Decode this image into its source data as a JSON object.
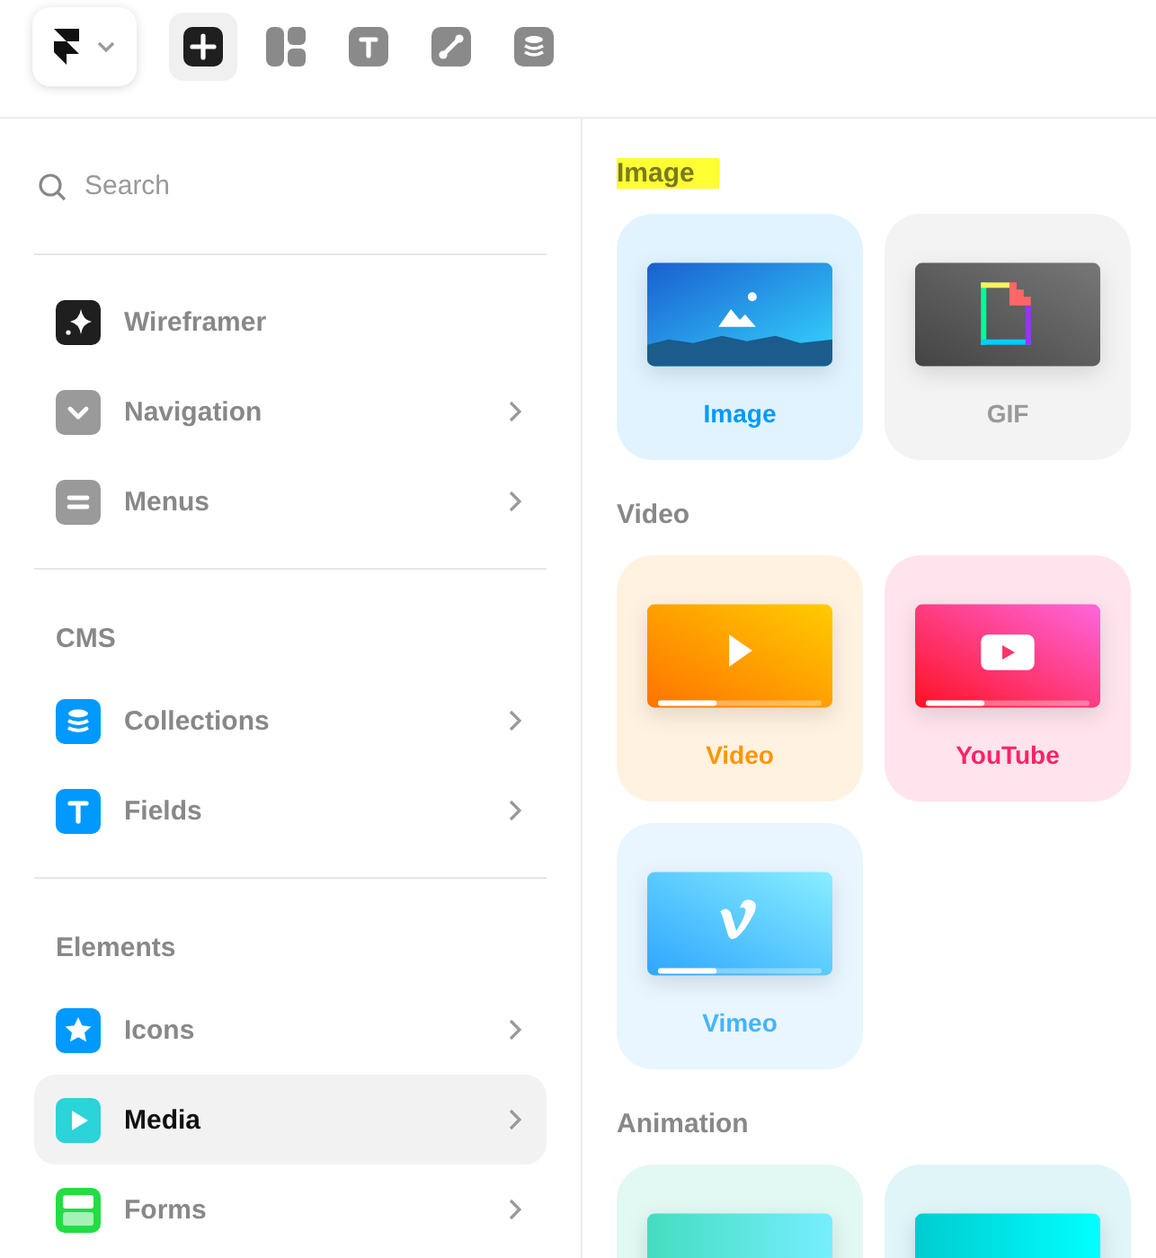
{
  "toolbar": {
    "tools": [
      {
        "kind": "insert",
        "selected": true
      },
      {
        "kind": "layout",
        "selected": false
      },
      {
        "kind": "text",
        "selected": false
      },
      {
        "kind": "vector",
        "selected": false
      },
      {
        "kind": "cms",
        "selected": false
      }
    ]
  },
  "sidebar": {
    "search": {
      "placeholder": "Search"
    },
    "groups": [
      {
        "items": [
          {
            "label": "Wireframer",
            "kind": "sparkle",
            "color": "#1f1f1f",
            "chevron": false,
            "selected": false
          },
          {
            "label": "Navigation",
            "kind": "chevron",
            "color": "#9a9a9a",
            "chevron": true,
            "selected": false
          },
          {
            "label": "Menus",
            "kind": "menu",
            "color": "#9a9a9a",
            "chevron": true,
            "selected": false
          }
        ]
      },
      {
        "title": "CMS",
        "items": [
          {
            "label": "Collections",
            "kind": "database",
            "color": "#0099ff",
            "chevron": true,
            "selected": false
          },
          {
            "label": "Fields",
            "kind": "text",
            "color": "#0099ff",
            "chevron": true,
            "selected": false
          }
        ]
      },
      {
        "title": "Elements",
        "items": [
          {
            "label": "Icons",
            "kind": "star",
            "color": "#0099ff",
            "chevron": true,
            "selected": false
          },
          {
            "label": "Media",
            "kind": "play",
            "color": "#2ad4d8",
            "chevron": true,
            "selected": true
          },
          {
            "label": "Forms",
            "kind": "form",
            "color": "#22dd44",
            "chevron": true,
            "selected": false
          }
        ]
      }
    ]
  },
  "panel": {
    "sections": [
      {
        "title": "Image",
        "highlighted": true,
        "cards": [
          {
            "label": "Image",
            "kind": "image",
            "color": "#0099ff"
          },
          {
            "label": "GIF",
            "kind": "gif",
            "color": "#999999"
          }
        ]
      },
      {
        "title": "Video",
        "highlighted": false,
        "cards": [
          {
            "label": "Video",
            "kind": "video",
            "color": "#ff9500"
          },
          {
            "label": "YouTube",
            "kind": "youtube",
            "color": "#ff2266"
          },
          {
            "label": "Vimeo",
            "kind": "vimeo",
            "color": "#44b4ff"
          }
        ]
      },
      {
        "title": "Animation",
        "highlighted": false,
        "cards": [
          {
            "kind": "anim-a"
          },
          {
            "kind": "anim-b"
          }
        ]
      }
    ]
  }
}
